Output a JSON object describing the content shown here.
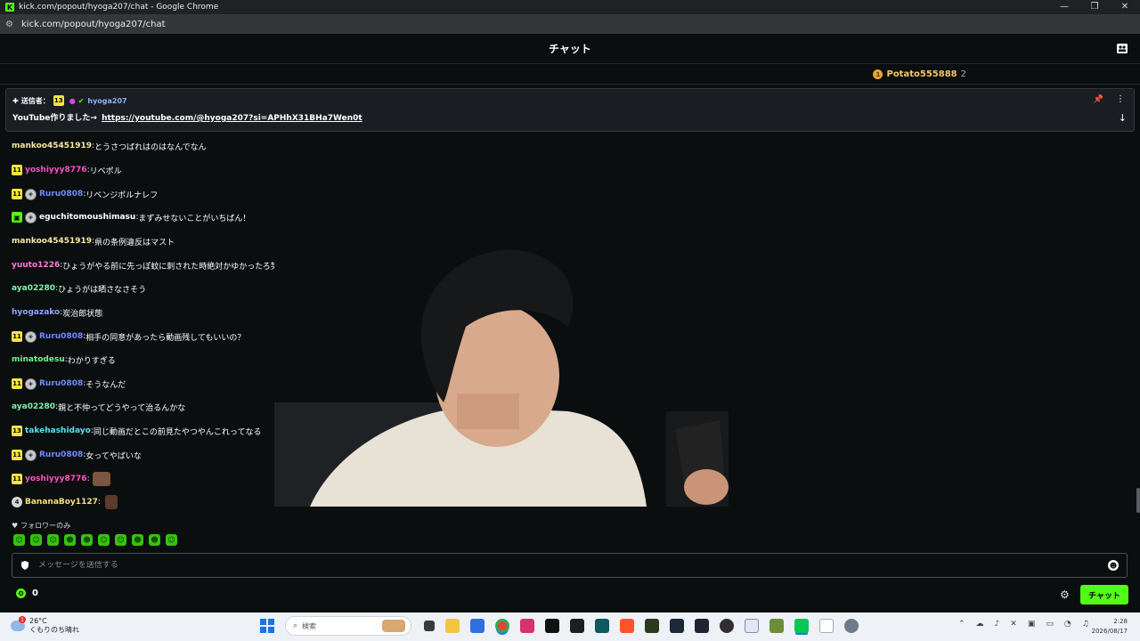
{
  "window": {
    "title": "kick.com/popout/hyoga207/chat - Google Chrome",
    "url": "kick.com/popout/hyoga207/chat",
    "controls": [
      "—",
      "❐",
      "✕"
    ]
  },
  "header": {
    "title": "チャット"
  },
  "top_gifter": {
    "name": "Potato555888",
    "count": "2",
    "coin": "1"
  },
  "pinned": {
    "sender_label": "送信者：",
    "badge": "13",
    "user": "hyoga207",
    "text": "YouTube作りました→",
    "link": "https://youtube.com/@hyoga207?si=APHhX31BHa7Wen0t"
  },
  "messages": [
    {
      "badges": [],
      "user": "mankoo45451919",
      "color": "#f7e9a0",
      "text": "とうさつばれはのはなんでなん"
    },
    {
      "badges": [
        "11"
      ],
      "user": "yoshiyyy8776",
      "color": "#ff4fc8",
      "text": "リベポル"
    },
    {
      "badges": [
        "11",
        "shield"
      ],
      "user": "Ruru0808",
      "color": "#6f8cff",
      "text": "リベンジポルナレフ"
    },
    {
      "badges": [
        "gift",
        "shield"
      ],
      "user": "eguchitomoushimasu",
      "color": "#ffffff",
      "text": "まずみせないことがいちばん！"
    },
    {
      "badges": [],
      "user": "mankoo45451919",
      "color": "#f7e9a0",
      "text": "県の条例違反はマスト"
    },
    {
      "badges": [],
      "user": "yuuto1226",
      "color": "#ff7ad9",
      "text": "ひょうがやる前に先っぽ蚊に刺された時絶対かゆかったろ笑"
    },
    {
      "badges": [],
      "user": "aya02280",
      "color": "#7cf6a6",
      "text": "ひょうがは晒さなさそう"
    },
    {
      "badges": [],
      "user": "hyogazako",
      "color": "#8da4ff",
      "text": "炭治郎状態"
    },
    {
      "badges": [
        "11",
        "shield"
      ],
      "user": "Ruru0808",
      "color": "#6f8cff",
      "text": "相手の同意があったら動画残してもいいの？"
    },
    {
      "badges": [],
      "user": "minatodesu",
      "color": "#6df58a",
      "text": "わかりすぎる"
    },
    {
      "badges": [
        "11",
        "shield"
      ],
      "user": "Ruru0808",
      "color": "#6f8cff",
      "text": "そうなんだ"
    },
    {
      "badges": [],
      "user": "aya02280",
      "color": "#7cf6a6",
      "text": "親と不仲ってどうやって治るんかな"
    },
    {
      "badges": [
        "13"
      ],
      "user": "takehashidayo",
      "color": "#5ee0f0",
      "text": "同じ動画だとこの前見たやつやんこれってなる"
    },
    {
      "badges": [
        "11",
        "shield"
      ],
      "user": "Ruru0808",
      "color": "#6f8cff",
      "text": "女ってやばいな"
    },
    {
      "badges": [
        "11"
      ],
      "user": "yoshiyyy8776",
      "color": "#ff4fc8",
      "text": "",
      "emote": "face"
    },
    {
      "badges": [
        "4"
      ],
      "user": "BananaBoy1127",
      "color": "#f4e07a",
      "text": "",
      "emote": "small"
    }
  ],
  "follower_only": "フォロワーのみ",
  "emotes": [
    "☺",
    "☺",
    "☺",
    "☻",
    "☻",
    "☺",
    "☺",
    "☻",
    "☻",
    "☺"
  ],
  "input": {
    "placeholder": "メッセージを送信する"
  },
  "points": "0",
  "send_button": "チャット",
  "taskbar": {
    "alert_count": "1",
    "temp": "26°C",
    "weather": "くもりのち晴れ",
    "search_placeholder": "検索",
    "time": "2:28",
    "date": "2026/08/17"
  }
}
